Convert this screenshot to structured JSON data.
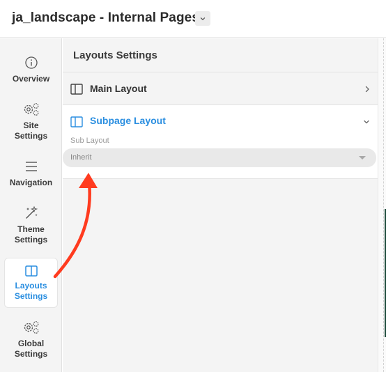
{
  "header": {
    "title": "ja_landscape - Internal Pages"
  },
  "sidebar": {
    "items": [
      {
        "label": "Overview"
      },
      {
        "label": "Site\nSettings"
      },
      {
        "label": "Navigation"
      },
      {
        "label": "Theme\nSettings"
      },
      {
        "label": "Layouts\nSettings"
      },
      {
        "label": "Global\nSettings"
      }
    ]
  },
  "main": {
    "heading": "Layouts Settings",
    "rows": [
      {
        "label": "Main Layout"
      },
      {
        "label": "Subpage Layout",
        "expanded": true
      }
    ],
    "sub_layout": {
      "label": "Sub Layout",
      "value": "Inherit"
    }
  },
  "colors": {
    "accent": "#2a8ee0",
    "annotation": "#ff3b1f"
  }
}
